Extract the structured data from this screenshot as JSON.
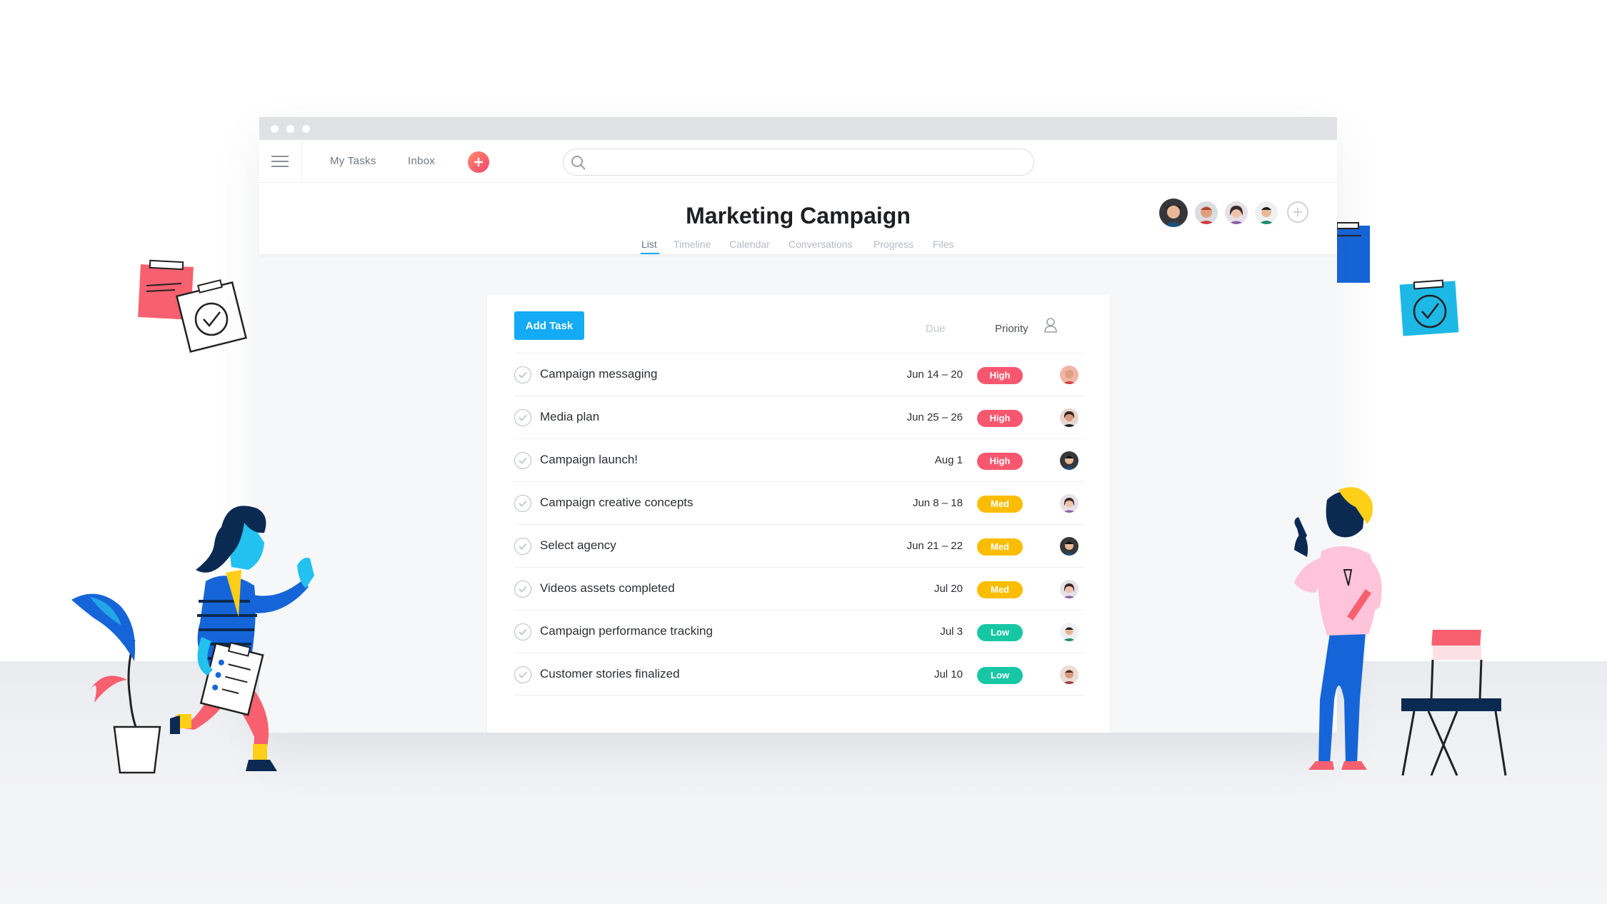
{
  "nav": {
    "my_tasks": "My Tasks",
    "inbox": "Inbox"
  },
  "search": {
    "placeholder": ""
  },
  "project": {
    "title": "Marketing Campaign",
    "tabs": [
      {
        "label": "List",
        "active": true
      },
      {
        "label": "Timeline",
        "active": false
      },
      {
        "label": "Calendar",
        "active": false
      },
      {
        "label": "Conversations",
        "active": false
      },
      {
        "label": "Progress",
        "active": false
      },
      {
        "label": "Files",
        "active": false
      }
    ]
  },
  "list": {
    "add_task_label": "Add Task",
    "columns": {
      "due": "Due",
      "priority": "Priority"
    },
    "tasks": [
      {
        "name": "Campaign messaging",
        "due": "Jun 14 – 20",
        "priority": "High"
      },
      {
        "name": "Media plan",
        "due": "Jun 25 – 26",
        "priority": "High"
      },
      {
        "name": "Campaign launch!",
        "due": "Aug 1",
        "priority": "High"
      },
      {
        "name": "Campaign creative concepts",
        "due": "Jun 8 – 18",
        "priority": "Med"
      },
      {
        "name": "Select agency",
        "due": "Jun 21 – 22",
        "priority": "Med"
      },
      {
        "name": "Videos assets completed",
        "due": "Jul 20",
        "priority": "Med"
      },
      {
        "name": "Campaign performance tracking",
        "due": "Jul 3",
        "priority": "Low"
      },
      {
        "name": "Customer stories finalized",
        "due": "Jul 10",
        "priority": "Low"
      }
    ]
  },
  "colors": {
    "accent": "#14aaf5",
    "high": "#f7576e",
    "med": "#fcbd01",
    "low": "#17c7a4",
    "plus": "#f0456f"
  },
  "icons": [
    "hamburger-icon",
    "plus-icon",
    "search-icon",
    "add-member-icon",
    "assignee-icon",
    "checkmark-icon"
  ]
}
